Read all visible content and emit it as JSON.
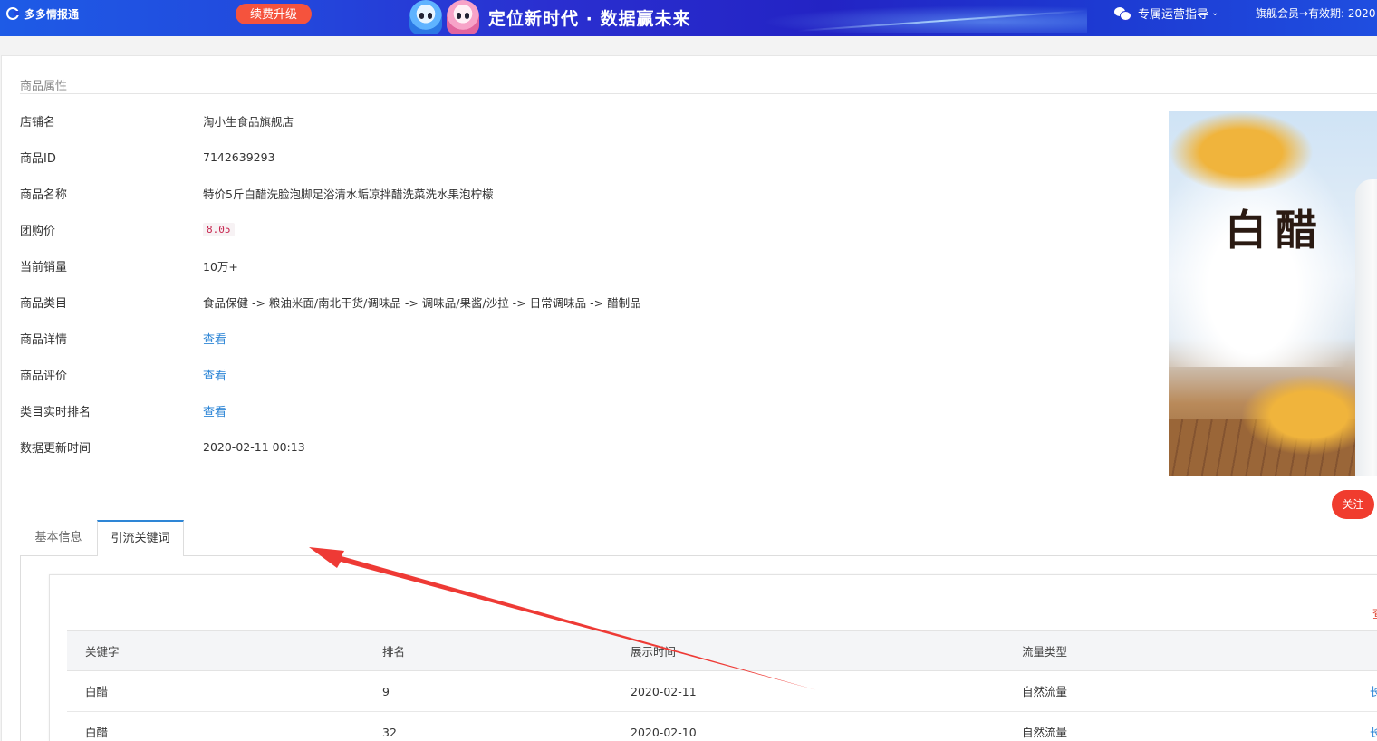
{
  "header": {
    "brand": "多多情报通",
    "renew_button": "续费升级",
    "slogan": "定位新时代 · 数据赢未来",
    "guide": "专属运营指导",
    "member": "旗舰会员→有效期: 2020-"
  },
  "attributes": {
    "section_title": "商品属性",
    "rows": [
      {
        "label": "店铺名",
        "value": "淘小生食品旗舰店"
      },
      {
        "label": "商品ID",
        "value": "7142639293"
      },
      {
        "label": "商品名称",
        "value": "特价5斤白醋洗脸泡脚足浴清水垢凉拌醋洗菜洗水果泡柠檬"
      },
      {
        "label": "团购价",
        "value": "8.05"
      },
      {
        "label": "当前销量",
        "value": "10万+"
      },
      {
        "label": "商品类目",
        "value": "食品保健 -> 粮油米面/南北干货/调味品 -> 调味品/果酱/沙拉 -> 日常调味品 -> 醋制品"
      },
      {
        "label": "商品详情",
        "value": "查看"
      },
      {
        "label": "商品评价",
        "value": "查看"
      },
      {
        "label": "类目实时排名",
        "value": "查看"
      },
      {
        "label": "数据更新时间",
        "value": "2020-02-11 00:13"
      }
    ]
  },
  "product_image": {
    "text": "白醋"
  },
  "follow_button": "关注",
  "tabs": [
    {
      "label": "基本信息",
      "active": false
    },
    {
      "label": "引流关键词",
      "active": true
    }
  ],
  "panel": {
    "corner_link": "查",
    "table": {
      "headers": [
        "关键字",
        "排名",
        "展示时间",
        "流量类型"
      ],
      "rows": [
        {
          "keyword": "白醋",
          "rank": "9",
          "date": "2020-02-11",
          "traffic": "自然流量",
          "action": "长"
        },
        {
          "keyword": "白醋",
          "rank": "32",
          "date": "2020-02-10",
          "traffic": "自然流量",
          "action": "长"
        }
      ]
    }
  },
  "colors": {
    "header_blue": "#2a2fd0",
    "renew_red": "#f5533d",
    "follow_red": "#f03c2e",
    "link_blue": "#2e86d6",
    "price_red": "#c7254e",
    "arrow_red": "#ee3a35"
  }
}
